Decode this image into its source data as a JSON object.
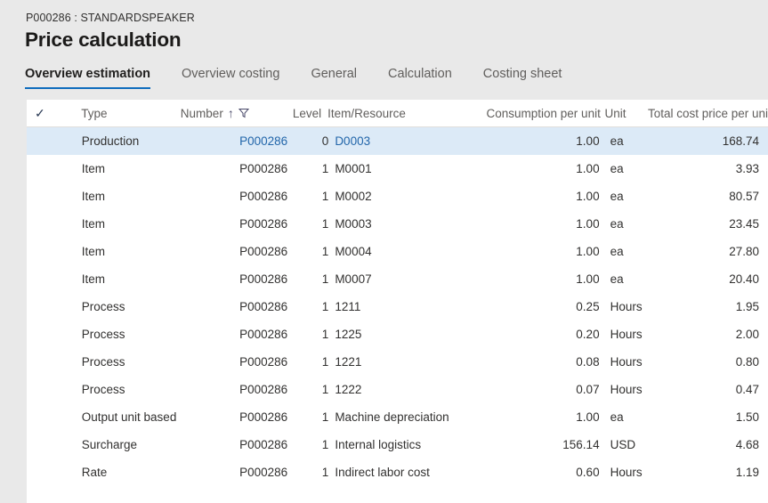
{
  "header": {
    "breadcrumb": "P000286 : STANDARDSPEAKER",
    "title": "Price calculation"
  },
  "tabs": [
    {
      "label": "Overview estimation",
      "active": true
    },
    {
      "label": "Overview costing",
      "active": false
    },
    {
      "label": "General",
      "active": false
    },
    {
      "label": "Calculation",
      "active": false
    },
    {
      "label": "Costing sheet",
      "active": false
    }
  ],
  "grid": {
    "select_all_icon": "checkmark-icon",
    "sort_indicator": "↑",
    "filter_icon": "filter-funnel-icon",
    "columns": {
      "type": "Type",
      "number": "Number",
      "level": "Level",
      "item_resource": "Item/Resource",
      "consumption": "Consumption per unit",
      "unit": "Unit",
      "total": "Total cost price per unit"
    },
    "accent_color": "#0f6cbd",
    "selected_row_color": "#dceaf7",
    "link_color": "#2266aa",
    "rows": [
      {
        "type": "Production",
        "number": "P000286",
        "level": "0",
        "item": "D0003",
        "consumption": "1.00",
        "unit": "ea",
        "total": "168.74",
        "selected": true,
        "number_is_link": true,
        "item_is_link": true
      },
      {
        "type": "Item",
        "number": "P000286",
        "level": "1",
        "item": "M0001",
        "consumption": "1.00",
        "unit": "ea",
        "total": "3.93",
        "selected": false,
        "number_is_link": false,
        "item_is_link": false
      },
      {
        "type": "Item",
        "number": "P000286",
        "level": "1",
        "item": "M0002",
        "consumption": "1.00",
        "unit": "ea",
        "total": "80.57",
        "selected": false,
        "number_is_link": false,
        "item_is_link": false
      },
      {
        "type": "Item",
        "number": "P000286",
        "level": "1",
        "item": "M0003",
        "consumption": "1.00",
        "unit": "ea",
        "total": "23.45",
        "selected": false,
        "number_is_link": false,
        "item_is_link": false
      },
      {
        "type": "Item",
        "number": "P000286",
        "level": "1",
        "item": "M0004",
        "consumption": "1.00",
        "unit": "ea",
        "total": "27.80",
        "selected": false,
        "number_is_link": false,
        "item_is_link": false
      },
      {
        "type": "Item",
        "number": "P000286",
        "level": "1",
        "item": "M0007",
        "consumption": "1.00",
        "unit": "ea",
        "total": "20.40",
        "selected": false,
        "number_is_link": false,
        "item_is_link": false
      },
      {
        "type": "Process",
        "number": "P000286",
        "level": "1",
        "item": "1211",
        "consumption": "0.25",
        "unit": "Hours",
        "total": "1.95",
        "selected": false,
        "number_is_link": false,
        "item_is_link": false
      },
      {
        "type": "Process",
        "number": "P000286",
        "level": "1",
        "item": "1225",
        "consumption": "0.20",
        "unit": "Hours",
        "total": "2.00",
        "selected": false,
        "number_is_link": false,
        "item_is_link": false
      },
      {
        "type": "Process",
        "number": "P000286",
        "level": "1",
        "item": "1221",
        "consumption": "0.08",
        "unit": "Hours",
        "total": "0.80",
        "selected": false,
        "number_is_link": false,
        "item_is_link": false
      },
      {
        "type": "Process",
        "number": "P000286",
        "level": "1",
        "item": "1222",
        "consumption": "0.07",
        "unit": "Hours",
        "total": "0.47",
        "selected": false,
        "number_is_link": false,
        "item_is_link": false
      },
      {
        "type": "Output unit based",
        "number": "P000286",
        "level": "1",
        "item": "Machine depreciation",
        "consumption": "1.00",
        "unit": "ea",
        "total": "1.50",
        "selected": false,
        "number_is_link": false,
        "item_is_link": false
      },
      {
        "type": "Surcharge",
        "number": "P000286",
        "level": "1",
        "item": "Internal logistics",
        "consumption": "156.14",
        "unit": "USD",
        "total": "4.68",
        "selected": false,
        "number_is_link": false,
        "item_is_link": false
      },
      {
        "type": "Rate",
        "number": "P000286",
        "level": "1",
        "item": "Indirect labor cost",
        "consumption": "0.60",
        "unit": "Hours",
        "total": "1.19",
        "selected": false,
        "number_is_link": false,
        "item_is_link": false
      }
    ]
  }
}
